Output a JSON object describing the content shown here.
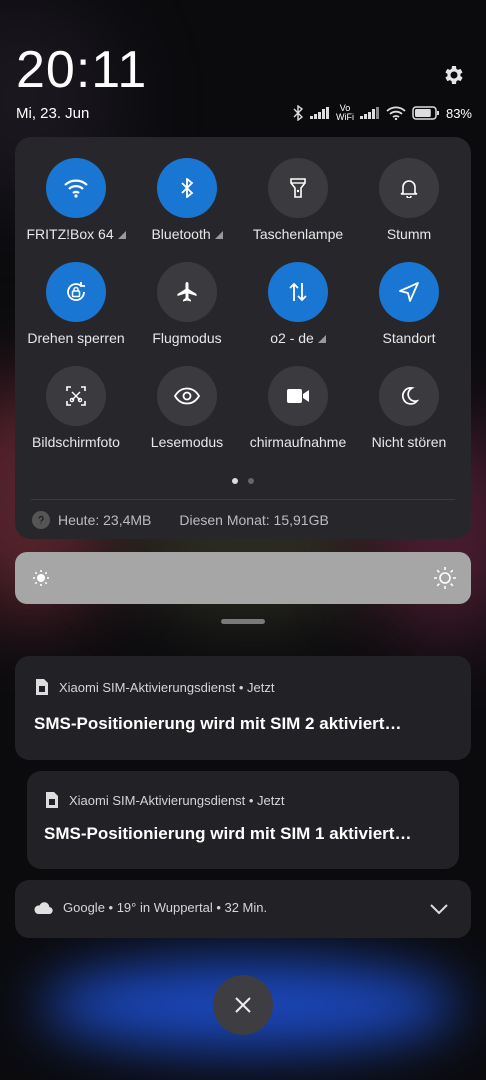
{
  "header": {
    "time": "20:11",
    "date": "Mi, 23. Jun"
  },
  "status_bar": {
    "vo": "Vo",
    "wifi_tag": "WiFi",
    "battery": "83%",
    "battery_level": 0.83
  },
  "tiles": [
    {
      "label": "FRITZ!Box 64",
      "icon": "wifi-icon",
      "active": true,
      "arrow": true
    },
    {
      "label": "Bluetooth",
      "icon": "bluetooth-icon",
      "active": true,
      "arrow": true
    },
    {
      "label": "Taschenlampe",
      "icon": "flashlight-icon",
      "active": false,
      "arrow": false
    },
    {
      "label": "Stumm",
      "icon": "bell-icon",
      "active": false,
      "arrow": false
    },
    {
      "label": "Drehen sperren",
      "icon": "rotation-lock-icon",
      "active": true,
      "arrow": false
    },
    {
      "label": "Flugmodus",
      "icon": "airplane-icon",
      "active": false,
      "arrow": false
    },
    {
      "label": "o2 - de",
      "icon": "mobile-data-icon",
      "active": true,
      "arrow": true
    },
    {
      "label": "Standort",
      "icon": "location-icon",
      "active": true,
      "arrow": false
    },
    {
      "label": "Bildschirmfoto",
      "icon": "screenshot-icon",
      "active": false,
      "arrow": false
    },
    {
      "label": "Lesemodus",
      "icon": "eye-icon",
      "active": false,
      "arrow": false
    },
    {
      "label": "chirmaufnahme",
      "icon": "video-camera-icon",
      "active": false,
      "arrow": false
    },
    {
      "label": "Nicht stören",
      "icon": "moon-icon",
      "active": false,
      "arrow": false
    }
  ],
  "usage": {
    "today": "Heute: 23,4MB",
    "month": "Diesen Monat: 15,91GB"
  },
  "notifications": [
    {
      "app": "Xiaomi SIM-Aktivierungsdienst • Jetzt",
      "title": "SMS-Positionierung wird mit SIM 2 aktiviert…"
    },
    {
      "app": "Xiaomi SIM-Aktivierungsdienst • Jetzt",
      "title": "SMS-Positionierung wird mit SIM 1 aktiviert…"
    }
  ],
  "weather": {
    "text": "Google • 19° in Wuppertal • 32 Min."
  },
  "colors": {
    "accent": "#1976d2",
    "panel": "#27272b",
    "card": "#222226"
  }
}
